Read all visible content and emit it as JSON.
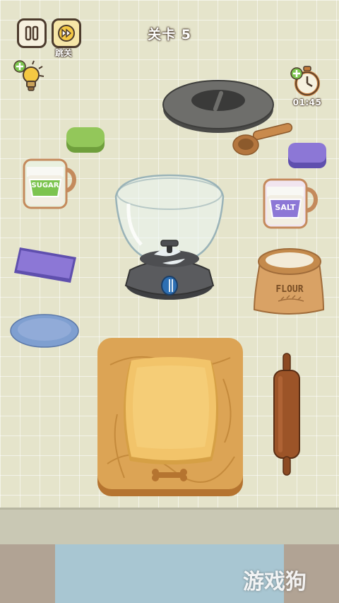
{
  "hud": {
    "skip_label": "跳关",
    "level_title": "关卡 5",
    "timer": "01:45"
  },
  "jars": {
    "sugar_label": "SUGAR",
    "salt_label": "SALT"
  },
  "sack": {
    "flour_label": "FLOUR"
  },
  "watermark": "游戏狗",
  "colors": {
    "background": "#e5e4cb",
    "wood_board": "#d9a24e",
    "dough": "#f2c46a",
    "lid": "#6b6b68",
    "blender_base": "#57585a",
    "accent_blue": "#2d6fb3",
    "purple_pad": "#8c77d6",
    "green_sponge": "#8cc35a"
  }
}
